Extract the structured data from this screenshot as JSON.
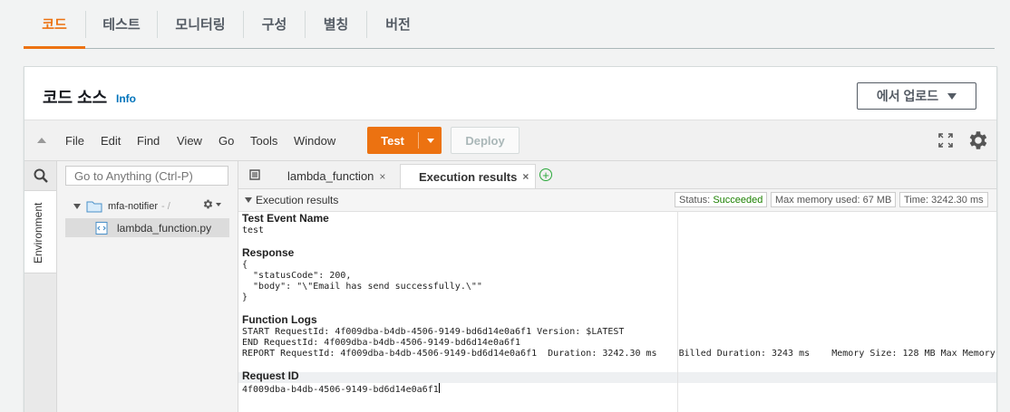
{
  "tabs": [
    {
      "label": "코드",
      "active": true
    },
    {
      "label": "테스트"
    },
    {
      "label": "모니터링"
    },
    {
      "label": "구성"
    },
    {
      "label": "별칭"
    },
    {
      "label": "버전"
    }
  ],
  "panel": {
    "title": "코드 소스",
    "info": "Info",
    "upload_label": "에서 업로드"
  },
  "ide": {
    "menu": [
      "File",
      "Edit",
      "Find",
      "View",
      "Go",
      "Tools",
      "Window"
    ],
    "test_label": "Test",
    "deploy_label": "Deploy",
    "goto_placeholder": "Go to Anything (Ctrl-P)",
    "environment_label": "Environment",
    "folder_name": "mfa-notifier",
    "folder_path": "- /",
    "file_name": "lambda_function.py",
    "editor_tabs": [
      {
        "label": "lambda_function",
        "close": "×"
      },
      {
        "label": "Execution results",
        "close": "×"
      }
    ],
    "add_tab": "+"
  },
  "execution": {
    "title": "Execution results",
    "status_label": "Status:",
    "status_value": "Succeeded",
    "memory": "Max memory used: 67 MB",
    "time": "Time: 3242.30 ms",
    "test_event_heading": "Test Event Name",
    "test_event_value": "test",
    "response_heading": "Response",
    "response_lines": [
      "{",
      "  \"statusCode\": 200,",
      "  \"body\": \"\\\"Email has send successfully.\\\"\"",
      "}"
    ],
    "logs_heading": "Function Logs",
    "log_lines": [
      "START RequestId: 4f009dba-b4db-4506-9149-bd6d14e0a6f1 Version: $LATEST",
      "END RequestId: 4f009dba-b4db-4506-9149-bd6d14e0a6f1",
      "REPORT RequestId: 4f009dba-b4db-4506-9149-bd6d14e0a6f1  Duration: 3242.30 ms    Billed Duration: 3243 ms    Memory Size: 128 MB Max Memory"
    ],
    "request_heading": "Request ID",
    "request_value": "4f009dba-b4db-4506-9149-bd6d14e0a6f1"
  },
  "colors": {
    "accent": "#ec7211",
    "link": "#0073bb",
    "success": "#1d8102"
  }
}
